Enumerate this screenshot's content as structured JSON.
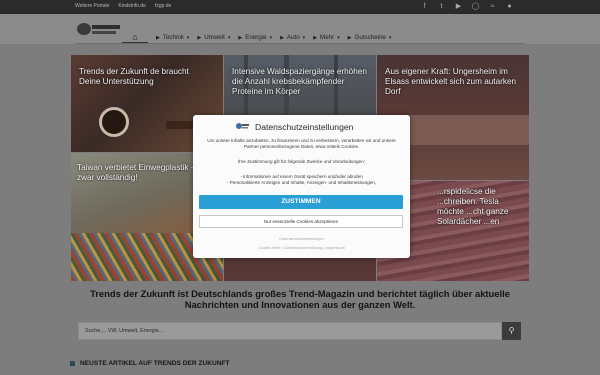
{
  "topbar": {
    "links": [
      "Weitere Portale",
      "Kindsinfo.de",
      "fzgp.de"
    ],
    "social": [
      "facebook-icon",
      "twitter-icon",
      "youtube-icon",
      "instagram-icon",
      "rss-icon",
      "user-icon"
    ]
  },
  "nav": {
    "home_icon": "⌂",
    "items": [
      {
        "label": "Technik",
        "caret": "▾"
      },
      {
        "label": "Umwelt",
        "caret": "▾"
      },
      {
        "label": "Energie",
        "caret": "▾"
      },
      {
        "label": "Auto",
        "caret": "▾"
      },
      {
        "label": "Mehr",
        "caret": "▾"
      },
      {
        "label": "Gutscheine",
        "caret": "▾"
      }
    ]
  },
  "tiles": [
    {
      "caption": "Trends der Zukunft de braucht Deine Unterstützung"
    },
    {
      "caption": "Intensive Waldspaziergänge erhöhen die Anzahl krebsbekämpfender Proteine im Körper"
    },
    {
      "caption": "Aus eigener Kraft: Ungersheim im Elsass entwickelt sich zum autarken Dorf"
    },
    {
      "caption": "Taiwan verbietet Einwegplastik – und zwar vollständig!"
    },
    {
      "caption": "...rspidelicse die ...chreiben. Tesla möchte ...cht ganze Solardächer ...en"
    }
  ],
  "tagline": "Trends der Zukunft ist Deutschlands großes Trend-Magazin und berichtet täglich über aktuelle Nachrichten und Innovationen aus der ganzen Welt.",
  "search": {
    "placeholder": "Suche,... VW, Umwelt, Energie...",
    "button_icon": "⚲"
  },
  "section_title": "NEUSTE ARTIKEL AUF TRENDS DER ZUKUNFT",
  "consent": {
    "title": "Datenschutzeinstellungen",
    "intro": "Um unsere Inhalte anzubieten, zu finanzieren und zu verbessern, verarbeiten wir und unsere Partner personenbezogene Daten, etwa mittels Cookies.",
    "purposes_heading": "Ihre Zustimmung gilt für folgende Zwecke und Verarbeitungen:",
    "purpose_1": "- Informationen auf einem Gerät speichern und/oder abrufen",
    "purpose_2": "- Personalisierte Anzeigen und Inhalte, Anzeigen- und Inhaltsmessungen,",
    "accept_label": "ZUSTIMMEN",
    "essential_label": "Nur essenzielle Cookies akzeptieren",
    "settings_link": "Datenschutzeinstellungen",
    "footer_links": "Cookie-Hilfen | Datenschutzerklärung | Impressum"
  },
  "colors": {
    "accent": "#2a9fd6",
    "topbar": "#2b2b2b"
  }
}
